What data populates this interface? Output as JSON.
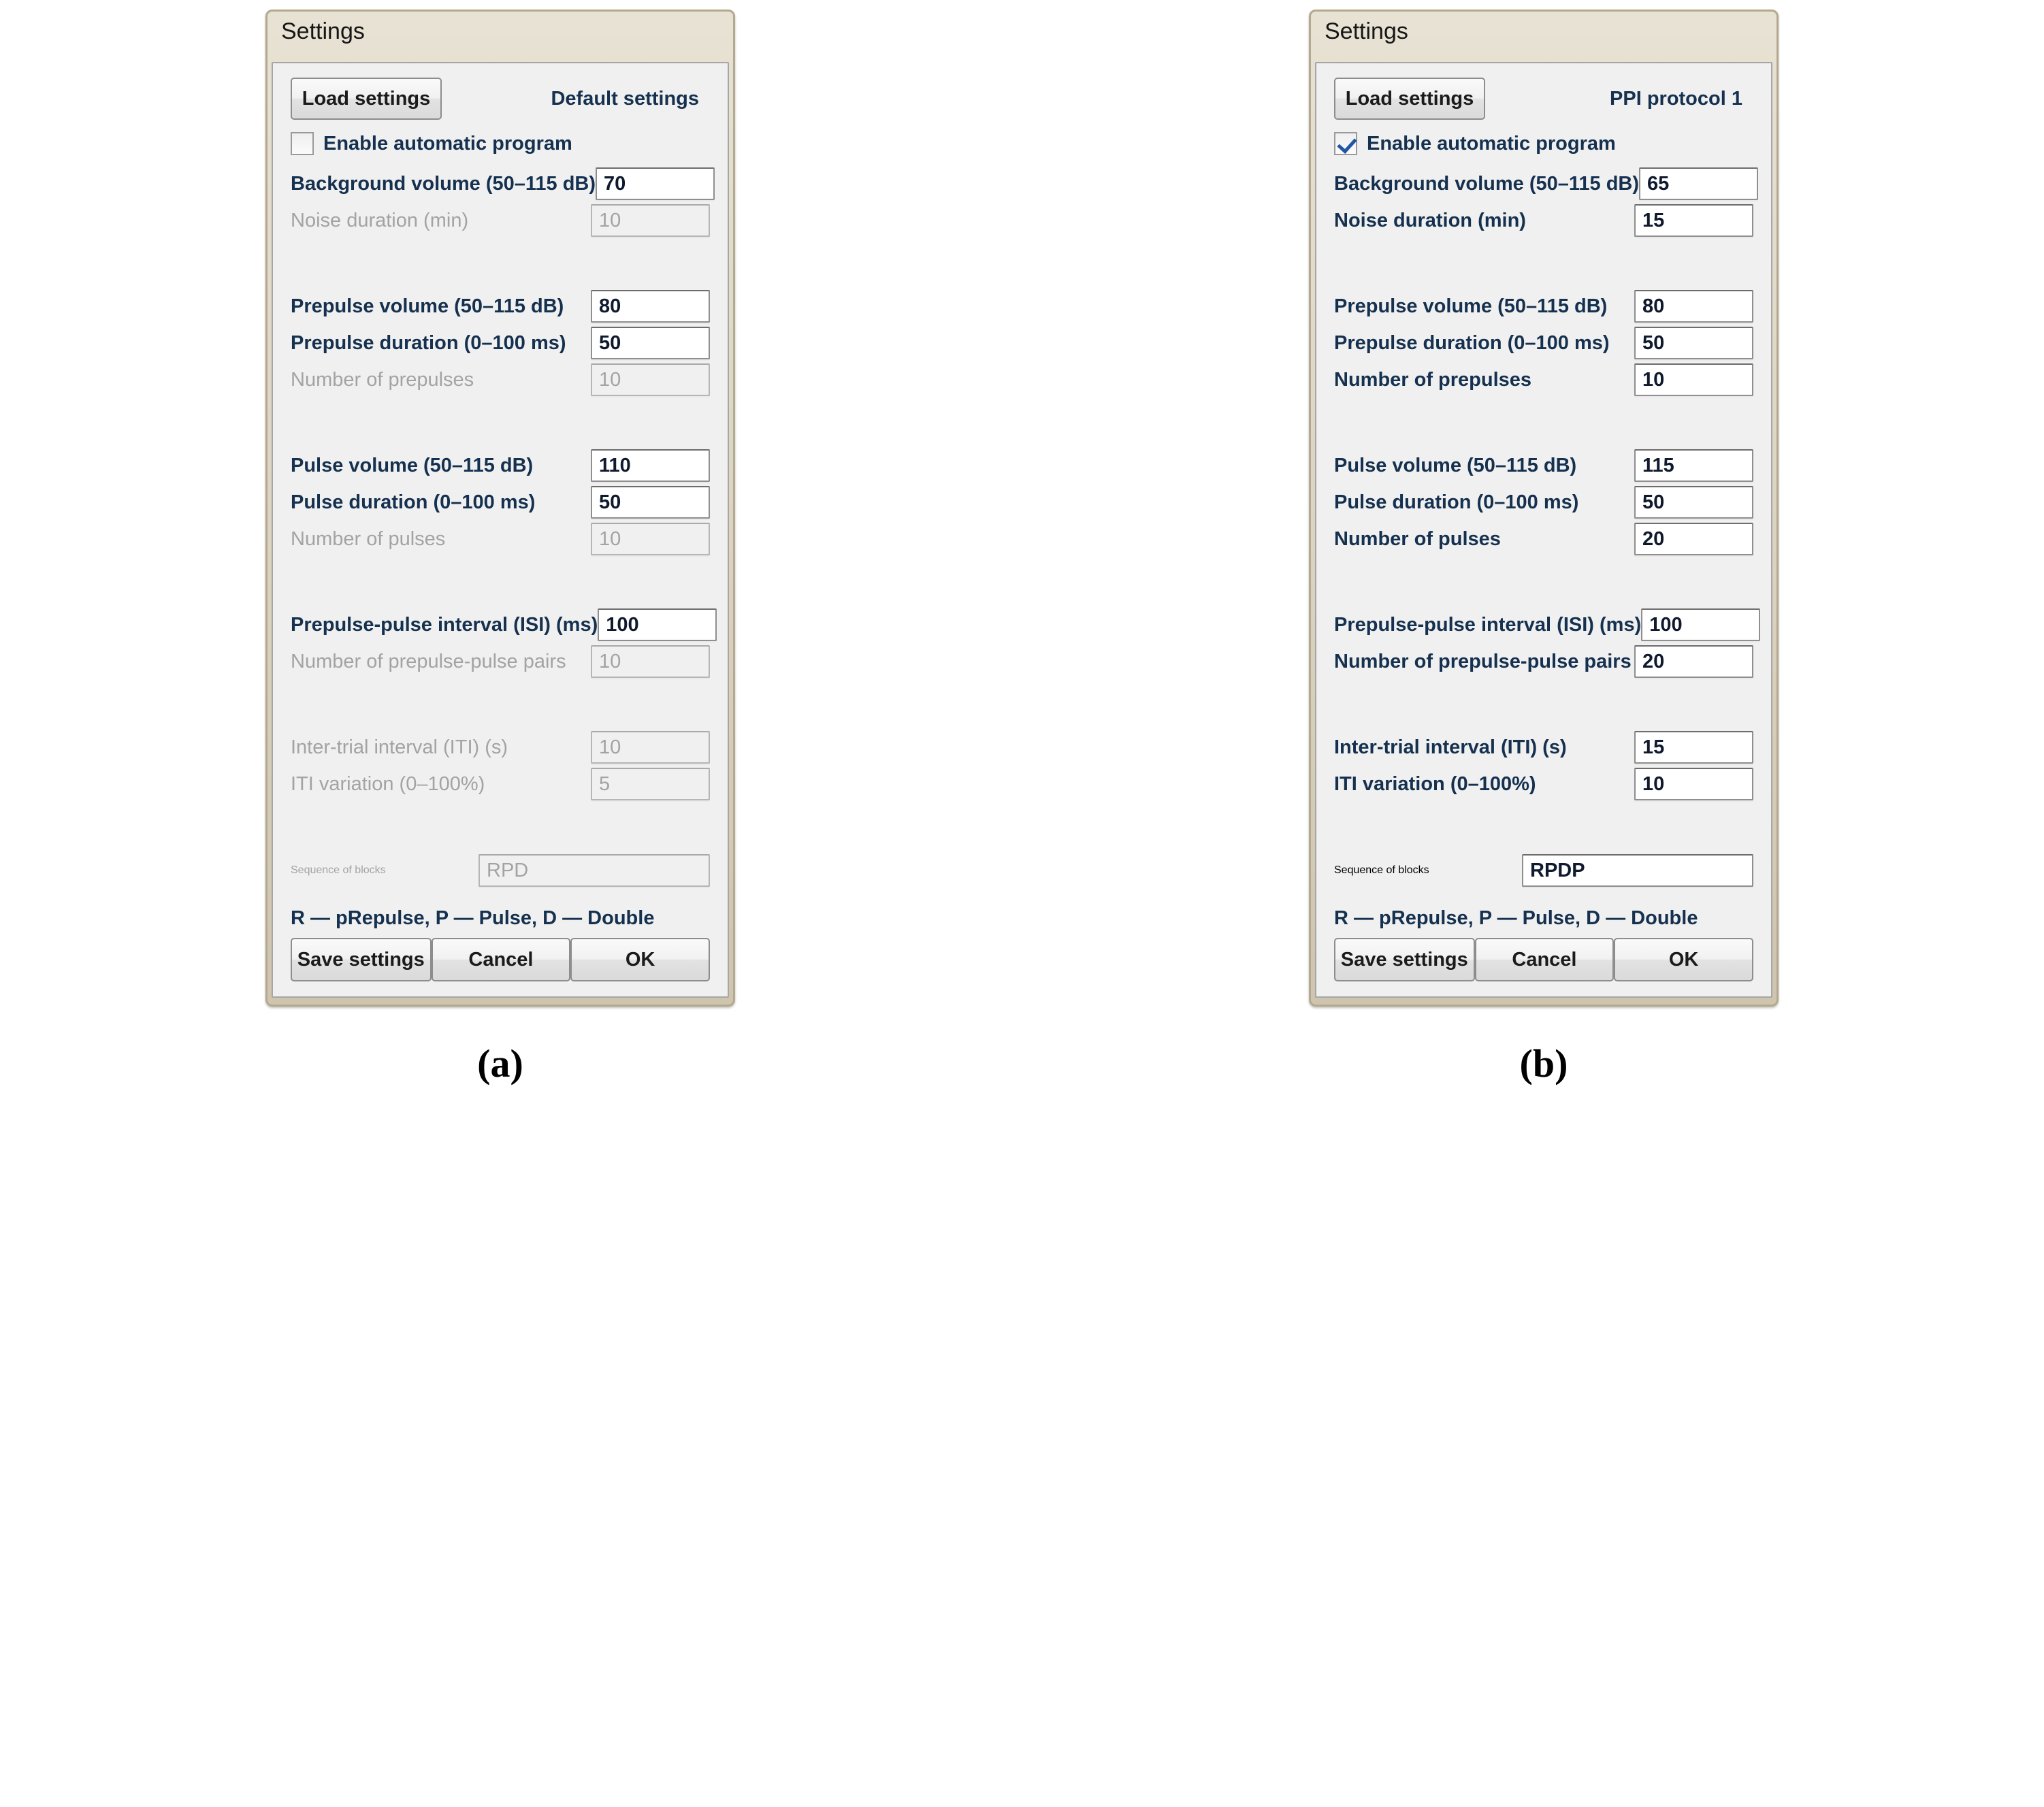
{
  "figure": {
    "caption_a": "(a)",
    "caption_b": "(b)"
  },
  "panel_a": {
    "window_title": "Settings",
    "load_button": "Load settings",
    "preset_label": "Default settings",
    "auto_program": {
      "label": "Enable automatic program",
      "checked": false
    },
    "rows": [
      {
        "label": "Background volume (50–115 dB)",
        "value": "70",
        "enabled": true
      },
      {
        "label": "Noise duration (min)",
        "value": "10",
        "enabled": false
      },
      {
        "label": "Prepulse volume (50–115 dB)",
        "value": "80",
        "enabled": true
      },
      {
        "label": "Prepulse duration (0–100 ms)",
        "value": "50",
        "enabled": true
      },
      {
        "label": "Number of prepulses",
        "value": "10",
        "enabled": false
      },
      {
        "label": "Pulse volume (50–115 dB)",
        "value": "110",
        "enabled": true
      },
      {
        "label": "Pulse duration (0–100 ms)",
        "value": "50",
        "enabled": true
      },
      {
        "label": "Number of pulses",
        "value": "10",
        "enabled": false
      },
      {
        "label": "Prepulse-pulse interval (ISI) (ms)",
        "value": "100",
        "enabled": true
      },
      {
        "label": "Number of prepulse-pulse pairs",
        "value": "10",
        "enabled": false
      },
      {
        "label": "Inter-trial interval (ITI) (s)",
        "value": "10",
        "enabled": false
      },
      {
        "label": "ITI variation (0–100%)",
        "value": "5",
        "enabled": false
      }
    ],
    "sequence": {
      "label": "Sequence of blocks",
      "value": "RPD",
      "enabled": false
    },
    "legend": "R — pRepulse, P — Pulse, D — Double",
    "footer": {
      "save": "Save settings",
      "cancel": "Cancel",
      "ok": "OK"
    }
  },
  "panel_b": {
    "window_title": "Settings",
    "load_button": "Load settings",
    "preset_label": "PPI protocol 1",
    "auto_program": {
      "label": "Enable automatic program",
      "checked": true
    },
    "rows": [
      {
        "label": "Background volume (50–115 dB)",
        "value": "65",
        "enabled": true
      },
      {
        "label": "Noise duration (min)",
        "value": "15",
        "enabled": true
      },
      {
        "label": "Prepulse volume (50–115 dB)",
        "value": "80",
        "enabled": true
      },
      {
        "label": "Prepulse duration (0–100 ms)",
        "value": "50",
        "enabled": true
      },
      {
        "label": "Number of prepulses",
        "value": "10",
        "enabled": true
      },
      {
        "label": "Pulse volume (50–115 dB)",
        "value": "115",
        "enabled": true
      },
      {
        "label": "Pulse duration (0–100 ms)",
        "value": "50",
        "enabled": true
      },
      {
        "label": "Number of pulses",
        "value": "20",
        "enabled": true
      },
      {
        "label": "Prepulse-pulse interval (ISI) (ms)",
        "value": "100",
        "enabled": true
      },
      {
        "label": "Number of prepulse-pulse pairs",
        "value": "20",
        "enabled": true
      },
      {
        "label": "Inter-trial interval (ITI) (s)",
        "value": "15",
        "enabled": true
      },
      {
        "label": "ITI variation (0–100%)",
        "value": "10",
        "enabled": true
      }
    ],
    "sequence": {
      "label": "Sequence of blocks",
      "value": "RPDP",
      "enabled": true
    },
    "legend": "R — pRepulse, P — Pulse, D — Double",
    "footer": {
      "save": "Save settings",
      "cancel": "Cancel",
      "ok": "OK"
    }
  },
  "colors": {
    "titlebar_top": "#e8e2d4",
    "titlebar_bottom": "#cfc5ae",
    "client_bg": "#f0f0f0",
    "label_enabled": "#15314f",
    "label_disabled": "#a3a3a3",
    "checkmark": "#2455a4"
  }
}
